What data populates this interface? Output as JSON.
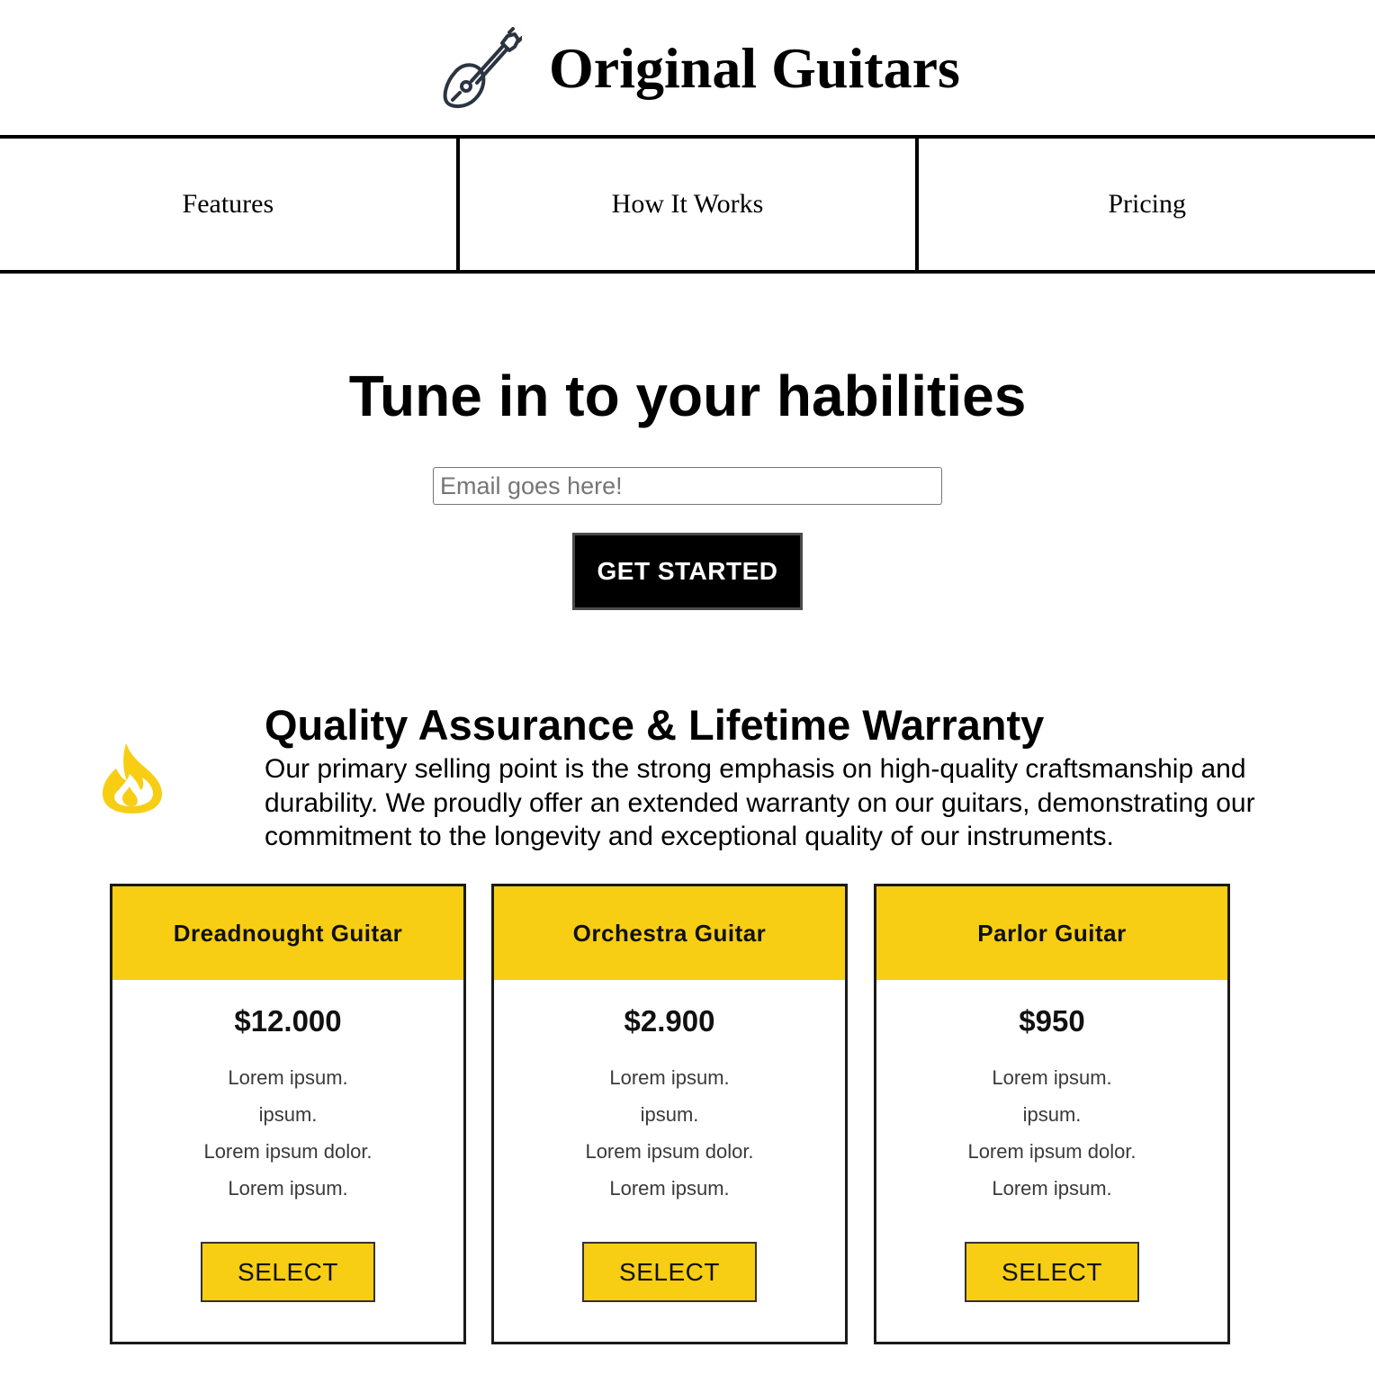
{
  "header": {
    "logo_icon": "guitar-icon",
    "title": "Original Guitars"
  },
  "nav": {
    "items": [
      {
        "label": "Features"
      },
      {
        "label": "How It Works"
      },
      {
        "label": "Pricing"
      }
    ]
  },
  "hero": {
    "title": "Tune in to your habilities",
    "email_placeholder": "Email goes here!",
    "cta_label": "GET STARTED"
  },
  "feature": {
    "icon": "fire-icon",
    "title": "Quality Assurance & Lifetime Warranty",
    "text": "Our primary selling point is the strong emphasis on high-quality craftsmanship and durability. We proudly offer an extended warranty on our guitars, demonstrating our commitment to the longevity and exceptional quality of our instruments."
  },
  "pricing": {
    "cards": [
      {
        "name": "Dreadnought Guitar",
        "price": "$12.000",
        "features": [
          "Lorem ipsum.",
          "ipsum.",
          "Lorem ipsum dolor.",
          "Lorem ipsum."
        ],
        "button_label": "SELECT"
      },
      {
        "name": "Orchestra Guitar",
        "price": "$2.900",
        "features": [
          "Lorem ipsum.",
          "ipsum.",
          "Lorem ipsum dolor.",
          "Lorem ipsum."
        ],
        "button_label": "SELECT"
      },
      {
        "name": "Parlor Guitar",
        "price": "$950",
        "features": [
          "Lorem ipsum.",
          "ipsum.",
          "Lorem ipsum dolor.",
          "Lorem ipsum."
        ],
        "button_label": "SELECT"
      }
    ]
  },
  "colors": {
    "accent": "#f7ce14",
    "button_dark": "#000000",
    "icon_stroke": "#2b3440"
  }
}
